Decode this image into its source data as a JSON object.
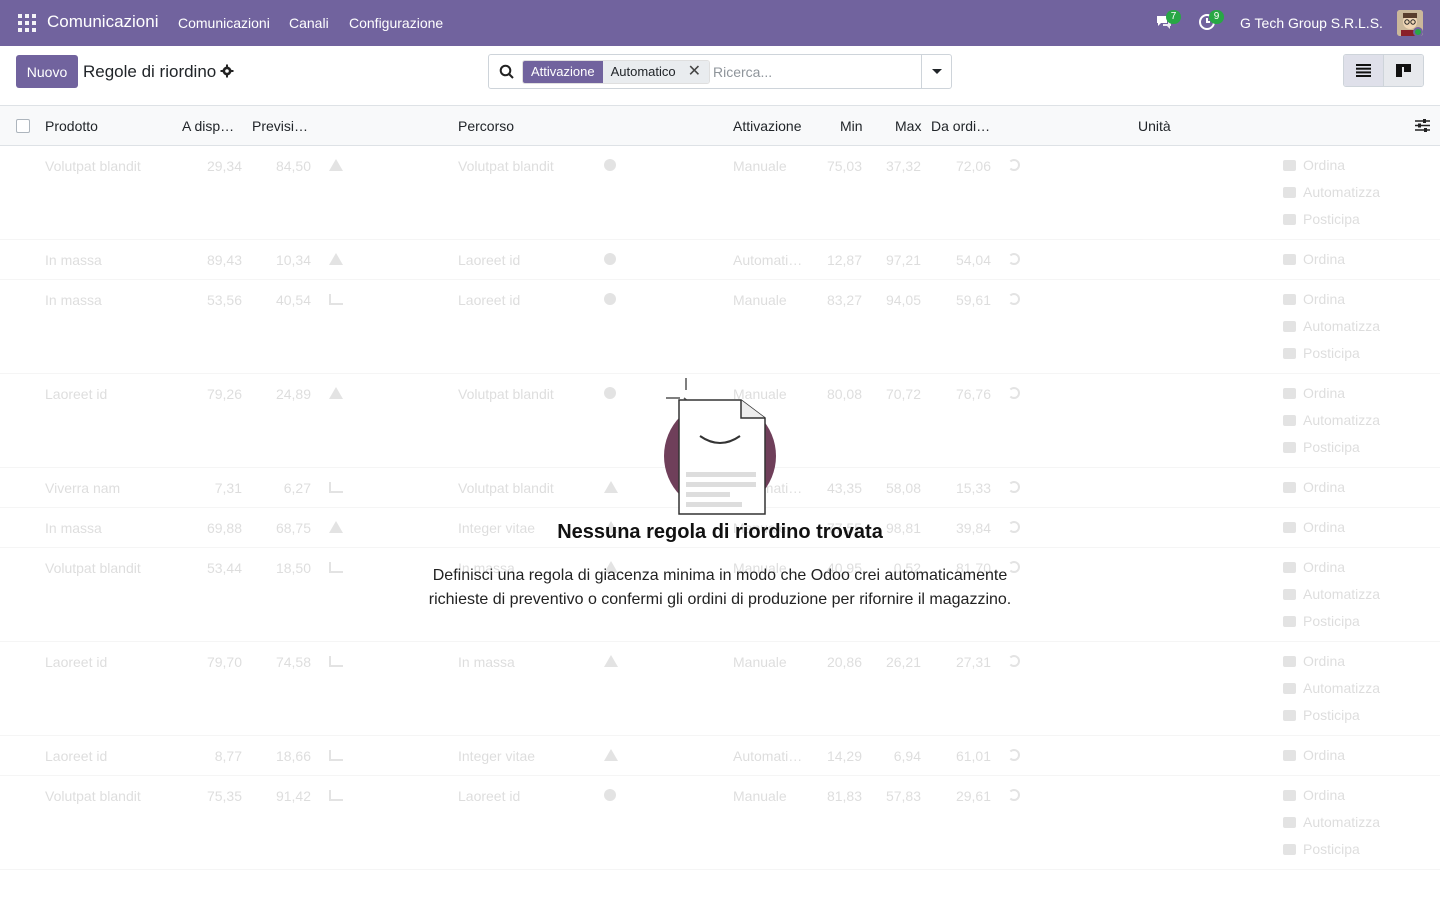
{
  "navbar": {
    "brand": "Comunicazioni",
    "menu": [
      "Comunicazioni",
      "Canali",
      "Configurazione"
    ],
    "messages_count": "7",
    "activities_count": "9",
    "company": "G Tech Group S.R.L.S."
  },
  "control": {
    "new_label": "Nuovo",
    "title": "Regole di riordino",
    "facet_label": "Attivazione",
    "facet_value": "Automatico",
    "search_placeholder": "Ricerca..."
  },
  "table": {
    "headers": [
      "Prodotto",
      "A disp…",
      "Previsi…",
      "Percorso",
      "Attivazione",
      "Min",
      "Max",
      "Da ordi…",
      "Unità"
    ],
    "rows": [
      {
        "product": "Volutpat blandit",
        "avail": "29,34",
        "forecast": "84,50",
        "fic": "tri",
        "route": "Volutpat blandit",
        "ric": "info",
        "activation": "Manuale",
        "min": "75,03",
        "max": "37,32",
        "order": "72,06",
        "actions": [
          "Ordina",
          "Automatizza",
          "Posticipa"
        ]
      },
      {
        "product": "In massa",
        "avail": "89,43",
        "forecast": "10,34",
        "fic": "tri",
        "route": "Laoreet id",
        "ric": "info",
        "activation": "Automati…",
        "min": "12,87",
        "max": "97,21",
        "order": "54,04",
        "actions": [
          "Ordina"
        ]
      },
      {
        "product": "In massa",
        "avail": "53,56",
        "forecast": "40,54",
        "fic": "chart",
        "route": "Laoreet id",
        "ric": "info",
        "activation": "Manuale",
        "min": "83,27",
        "max": "94,05",
        "order": "59,61",
        "actions": [
          "Ordina",
          "Automatizza",
          "Posticipa"
        ]
      },
      {
        "product": "Laoreet id",
        "avail": "79,26",
        "forecast": "24,89",
        "fic": "tri",
        "route": "Volutpat blandit",
        "ric": "info",
        "activation": "Manuale",
        "min": "80,08",
        "max": "70,72",
        "order": "76,76",
        "actions": [
          "Ordina",
          "Automatizza",
          "Posticipa"
        ]
      },
      {
        "product": "Viverra nam",
        "avail": "7,31",
        "forecast": "6,27",
        "fic": "chart",
        "route": "Volutpat blandit",
        "ric": "tri",
        "activation": "Automati…",
        "min": "43,35",
        "max": "58,08",
        "order": "15,33",
        "actions": [
          "Ordina"
        ]
      },
      {
        "product": "In massa",
        "avail": "69,88",
        "forecast": "68,75",
        "fic": "tri",
        "route": "Integer vitae",
        "ric": "tri",
        "activation": "Manuale",
        "min": "77,55",
        "max": "98,81",
        "order": "39,84",
        "actions": [
          "Ordina"
        ]
      },
      {
        "product": "Volutpat blandit",
        "avail": "53,44",
        "forecast": "18,50",
        "fic": "chart",
        "route": "In massa",
        "ric": "tri",
        "activation": "Manuale",
        "min": "40,95",
        "max": "0,52",
        "order": "81,70",
        "actions": [
          "Ordina",
          "Automatizza",
          "Posticipa"
        ]
      },
      {
        "product": "Laoreet id",
        "avail": "79,70",
        "forecast": "74,58",
        "fic": "chart",
        "route": "In massa",
        "ric": "tri",
        "activation": "Manuale",
        "min": "20,86",
        "max": "26,21",
        "order": "27,31",
        "actions": [
          "Ordina",
          "Automatizza",
          "Posticipa"
        ]
      },
      {
        "product": "Laoreet id",
        "avail": "8,77",
        "forecast": "18,66",
        "fic": "chart",
        "route": "Integer vitae",
        "ric": "tri",
        "activation": "Automati…",
        "min": "14,29",
        "max": "6,94",
        "order": "61,01",
        "actions": [
          "Ordina"
        ]
      },
      {
        "product": "Volutpat blandit",
        "avail": "75,35",
        "forecast": "91,42",
        "fic": "chart",
        "route": "Laoreet id",
        "ric": "info",
        "activation": "Manuale",
        "min": "81,83",
        "max": "57,83",
        "order": "29,61",
        "actions": [
          "Ordina",
          "Automatizza",
          "Posticipa"
        ]
      }
    ]
  },
  "empty": {
    "title": "Nessuna regola di riordino trovata",
    "line1": "Definisci una regola di giacenza minima in modo che Odoo crei automaticamente",
    "line2": "richieste di preventivo o confermi gli ordini di produzione per rifornire il magazzino."
  },
  "colors": {
    "brand": "#71639e",
    "badge": "#28a745"
  }
}
